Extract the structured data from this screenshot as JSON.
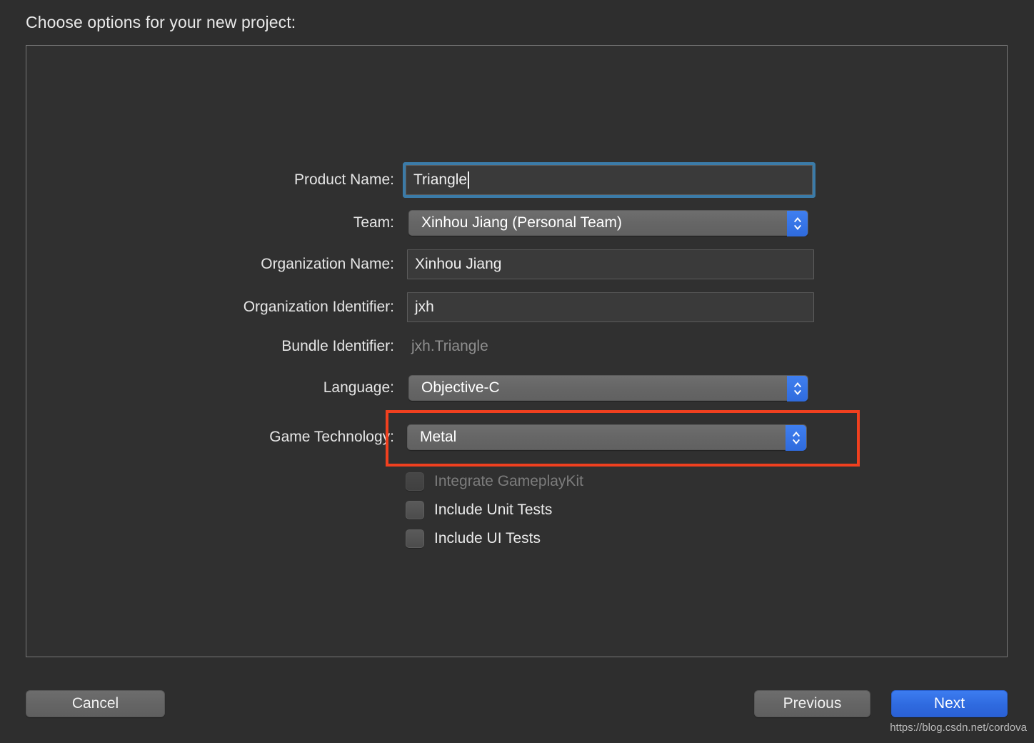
{
  "sheet": {
    "title": "Choose options for your new project:"
  },
  "form": {
    "fields": [
      {
        "label": "Product Name:",
        "value": "Triangle",
        "kind": "text-focused"
      },
      {
        "label": "Team:",
        "value": "Xinhou Jiang (Personal Team)",
        "kind": "popup"
      },
      {
        "label": "Organization Name:",
        "value": "Xinhou Jiang",
        "kind": "text"
      },
      {
        "label": "Organization Identifier:",
        "value": "jxh",
        "kind": "text"
      },
      {
        "label": "Bundle Identifier:",
        "value": "jxh.Triangle",
        "kind": "static"
      },
      {
        "label": "Language:",
        "value": "Objective-C",
        "kind": "popup"
      },
      {
        "label": "Game Technology:",
        "value": "Metal",
        "kind": "popup"
      }
    ],
    "checkboxes": [
      {
        "label": "Integrate GameplayKit",
        "checked": false,
        "disabled": true
      },
      {
        "label": "Include Unit Tests",
        "checked": false,
        "disabled": false
      },
      {
        "label": "Include UI Tests",
        "checked": false,
        "disabled": false
      }
    ]
  },
  "annotation": {
    "color": "#f0401f",
    "targets": "Game Technology: Metal"
  },
  "footer": {
    "cancel_label": "Cancel",
    "previous_label": "Previous",
    "next_label": "Next",
    "watermark": "https://blog.csdn.net/cordova"
  },
  "colors": {
    "window_bg": "#2e2e2e",
    "panel_bg": "#303030",
    "panel_border": "#767676",
    "focus_ring": "#3b7ba8",
    "accent_blue": "#2f6adf",
    "stepper_blue": "#3f7ff0",
    "annotation_red": "#f0401f",
    "disabled_text": "#8e8e8e"
  }
}
